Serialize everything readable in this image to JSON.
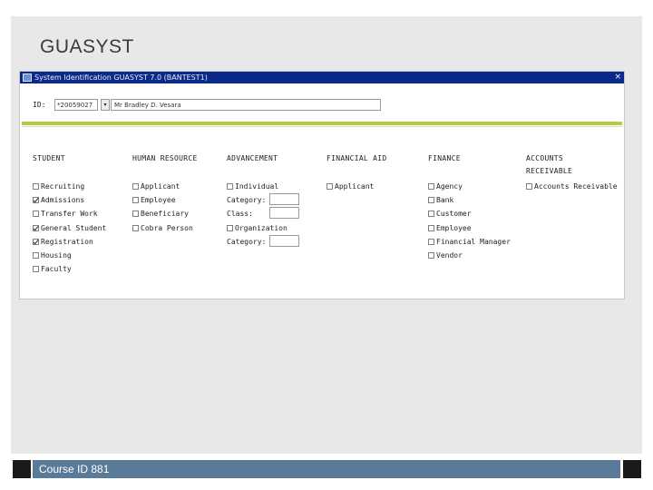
{
  "slide": {
    "title": "GUASYST",
    "footer": "Course ID 881"
  },
  "window": {
    "title": "System Identification  GUASYST 7.0  (BANTEST1)",
    "close_glyph": "×"
  },
  "key_block": {
    "id_label": "ID:",
    "id_value": "*20059027",
    "lov_glyph": "▾",
    "name_value": "Mr Bradley D. Vesara"
  },
  "columns": {
    "student": {
      "heading": "STUDENT",
      "items": [
        {
          "label": "Recruiting",
          "checked": false
        },
        {
          "label": "Admissions",
          "checked": true
        },
        {
          "label": "Transfer Work",
          "checked": false
        },
        {
          "label": "General Student",
          "checked": true
        },
        {
          "label": "Registration",
          "checked": true
        },
        {
          "label": "Housing",
          "checked": false
        },
        {
          "label": "Faculty",
          "checked": false
        }
      ]
    },
    "human_resource": {
      "heading": "HUMAN RESOURCE",
      "items": [
        {
          "label": "Applicant",
          "checked": false
        },
        {
          "label": "Employee",
          "checked": false
        },
        {
          "label": "Beneficiary",
          "checked": false
        },
        {
          "label": "Cobra Person",
          "checked": false
        }
      ]
    },
    "advancement": {
      "heading": "ADVANCEMENT",
      "individual": "Individual",
      "category_label": "Category:",
      "class_label": "Class:",
      "organization": "Organization",
      "category2_label": "Category:"
    },
    "financial_aid": {
      "heading": "FINANCIAL AID",
      "items": [
        {
          "label": "Applicant",
          "checked": false
        }
      ]
    },
    "finance": {
      "heading": "FINANCE",
      "items": [
        {
          "label": "Agency",
          "checked": false
        },
        {
          "label": "Bank",
          "checked": false
        },
        {
          "label": "Customer",
          "checked": false
        },
        {
          "label": "Employee",
          "checked": false
        },
        {
          "label": "Financial Manager",
          "checked": false
        },
        {
          "label": "Vendor",
          "checked": false
        }
      ]
    },
    "accounts": {
      "heading": "ACCOUNTS",
      "heading2": "RECEIVABLE",
      "items": [
        {
          "label": "Accounts Receivable",
          "checked": false
        }
      ]
    }
  }
}
